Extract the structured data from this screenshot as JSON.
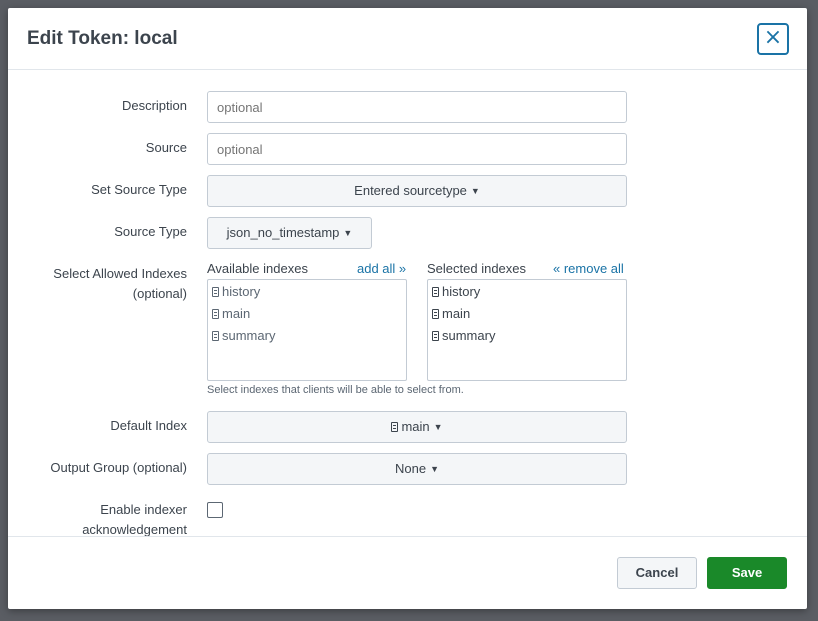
{
  "modal": {
    "title": "Edit Token: local",
    "close_icon": "×"
  },
  "form": {
    "description": {
      "label": "Description",
      "placeholder": "optional"
    },
    "source": {
      "label": "Source",
      "placeholder": "optional"
    },
    "set_source_type": {
      "label": "Set Source Type",
      "value": "Entered sourcetype"
    },
    "source_type": {
      "label": "Source Type",
      "value": "json_no_timestamp"
    },
    "allowed_indexes": {
      "label_line1": "Select Allowed Indexes",
      "label_line2": "(optional)",
      "available_header": "Available indexes",
      "add_all": "add all »",
      "selected_header": "Selected indexes",
      "remove_all": "« remove all",
      "available": [
        "history",
        "main",
        "summary"
      ],
      "selected": [
        "history",
        "main",
        "summary"
      ],
      "help": "Select indexes that clients will be able to select from."
    },
    "default_index": {
      "label": "Default Index",
      "value": "main"
    },
    "output_group": {
      "label": "Output Group (optional)",
      "value": "None"
    },
    "indexer_ack": {
      "label_line1": "Enable indexer",
      "label_line2": "acknowledgement",
      "checked": false
    }
  },
  "footer": {
    "cancel_label": "Cancel",
    "save_label": "Save"
  },
  "icons": {
    "caret": "caret-down-icon",
    "index": "database-icon"
  },
  "colors": {
    "accent": "#1a73a6",
    "save": "#1a8929"
  }
}
